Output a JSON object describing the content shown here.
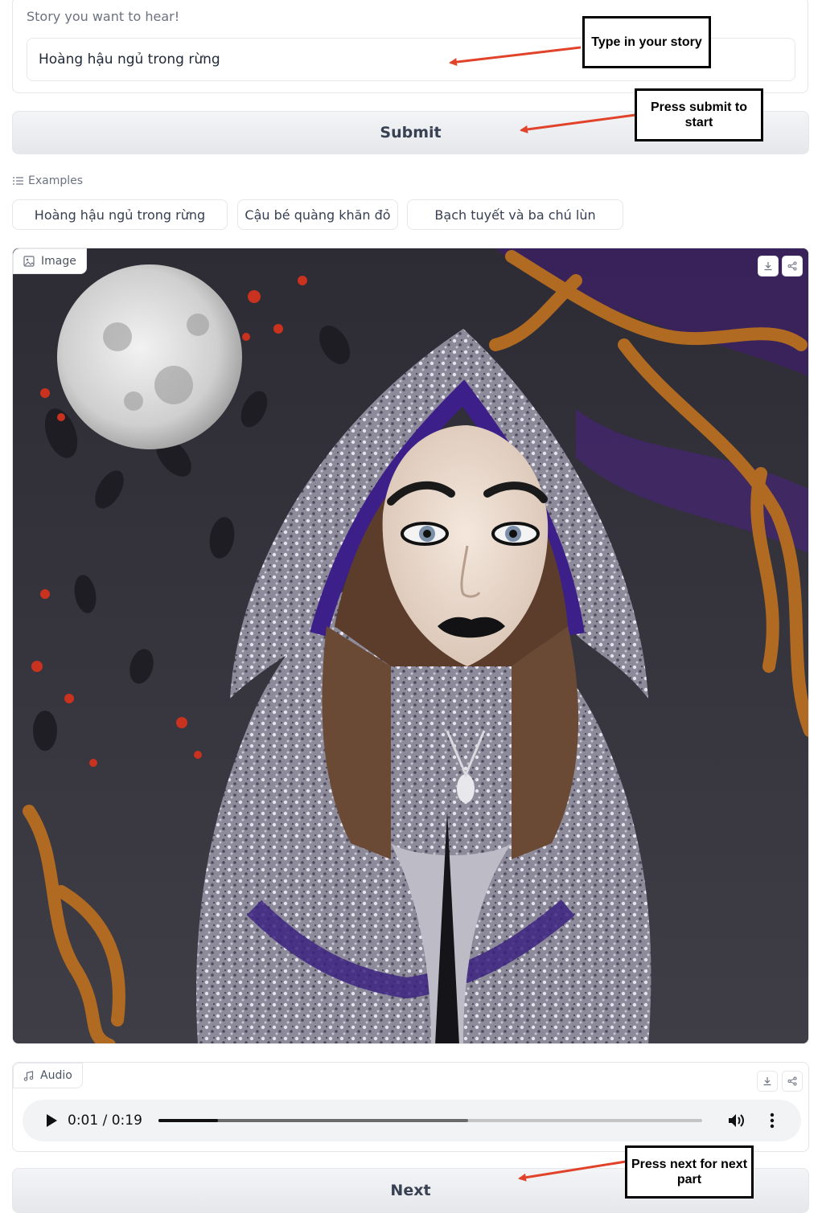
{
  "story_panel": {
    "label": "Story you want to hear!",
    "input_value": "Hoàng hậu ngủ trong rừng"
  },
  "submit_label": "Submit",
  "examples": {
    "title": "Examples",
    "items": [
      "Hoàng hậu ngủ trong rừng",
      "Cậu bé quàng khăn đỏ",
      "Bạch tuyết và ba chú lùn"
    ]
  },
  "image_panel": {
    "label": "Image",
    "icons": [
      "image-icon",
      "download-icon",
      "share-icon"
    ]
  },
  "audio_panel": {
    "label": "Audio",
    "time_display": "0:01 / 0:19",
    "progress": 0.11,
    "buffered": 0.57,
    "icons": [
      "music-note-icon",
      "download-icon",
      "share-icon",
      "play-icon",
      "volume-icon",
      "more-options-icon"
    ]
  },
  "next_label": "Next",
  "annotations": {
    "type_story": "Type in your story",
    "press_submit": "Press submit to start",
    "press_next": "Press next for next part",
    "arrow_color": "#e0432a"
  }
}
